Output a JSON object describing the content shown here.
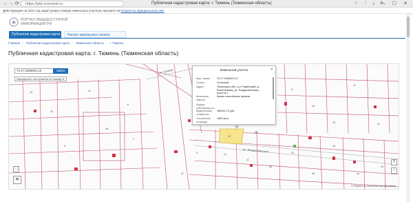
{
  "browser": {
    "url": "https://pkk.rosreestr.ru",
    "tab_title": "Публичная кадастровая карта: г. Тюмень (Тюменская область)",
    "nav_icons": "←  →  ⟳",
    "tool_icons": "☆ ⋮ ⤓ ⊕",
    "window_buttons": "– ☐ ✕"
  },
  "notice": {
    "text": "Действующие на 2021 год кадастровые номера земельных участков смотрите на ",
    "link": "Росреестр официальный сайт"
  },
  "header": {
    "logo_text": "ПОРТАЛ ОБЩЕДОСТУПНОЙ ИНФОРМАЦИИ РФ",
    "tabs": [
      {
        "label": "Публичная кадастровая карта"
      },
      {
        "label": "Расчет земельного налога"
      }
    ]
  },
  "breadcrumb": [
    "Главная",
    "Публичная кадастровая карта",
    "Тюменская область",
    "г. Тюмень"
  ],
  "page_title": "Публичная кадастровая карта: г. Тюмень (Тюменская область)",
  "search": {
    "value": "72:17:1506001:12",
    "button": "Найти",
    "select": "Определить тип объекта по номеру ▾"
  },
  "popup": {
    "title": "Земельный участок",
    "close": "✕",
    "rows": [
      {
        "key": "Кад. номер:",
        "value": "72:17:1506001:12"
      },
      {
        "key": "Статус:",
        "value": "Учтенный"
      },
      {
        "key": "Адрес:",
        "value": "Тюменская обл., р-н Тюменский, д. Решетникова, ул. Рождественская, участок 1"
      },
      {
        "key": "Категория земель:",
        "value": "Земли населённых пунктов"
      },
      {
        "key": "Форма собственности:",
        "value": ""
      },
      {
        "key": "Кадастровая стоимость:",
        "value": "180041.72 руб."
      },
      {
        "key": "Уточнённая площадь:",
        "value": "1500 кв.м"
      }
    ]
  },
  "map": {
    "street_labels": [
      "ул. Луговая",
      "ул. Рождественская"
    ],
    "parcel_numbers": [
      "12",
      "131",
      "14",
      "29",
      "12",
      "46",
      "5",
      "6",
      "7",
      "9",
      "10",
      "11",
      "32",
      "8",
      "13",
      "15",
      "17",
      "21",
      "22",
      "33",
      "44",
      "15",
      "19",
      "27"
    ],
    "copyright": "© Росреестр, Участники OpenStreetMap",
    "zoom_in": "+",
    "zoom_out": "−",
    "fullscreen": "⛶",
    "layers": "≋"
  },
  "colors": {
    "accent": "#1f6fb8",
    "highlight_parcel": "#f6e58d",
    "building": "#d2334a",
    "parcel_line": "#c0506a"
  }
}
